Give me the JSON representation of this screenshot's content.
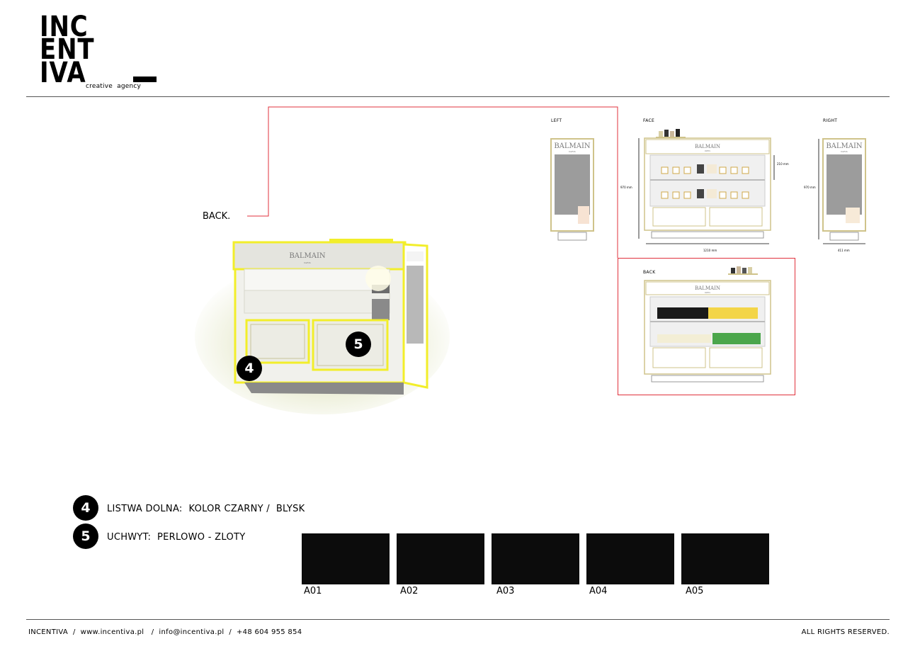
{
  "logo": {
    "lines": [
      "INC",
      "ENT",
      "IVA"
    ],
    "tagline": "creative  agency"
  },
  "render": {
    "back_label": "BACK.",
    "brand": "BALMAIN",
    "brand_sub": "PARIS",
    "markers": [
      "4",
      "5"
    ],
    "highlight_color": "#f2ee2a",
    "connector_color": "#e0313c"
  },
  "views": {
    "left_label": "LEFT",
    "face_label": "FACE",
    "right_label": "RIGHT",
    "back_label": "BACK",
    "height_face": "970 mm",
    "height_right": "970 mm",
    "shelf_height": "210 mm",
    "width_face": "1210 mm",
    "width_right": "411 mm",
    "brand": "BALMAIN",
    "brand_sub": "PARIS"
  },
  "legend": [
    {
      "number": "4",
      "text": "LISTWA DOLNA:  KOLOR CZARNY /  BLYSK"
    },
    {
      "number": "5",
      "text": "UCHWYT:  PERLOWO - ZLOTY"
    }
  ],
  "swatches": [
    {
      "code": "A01",
      "color": "#0c0c0c"
    },
    {
      "code": "A02",
      "color": "#0c0c0c"
    },
    {
      "code": "A03",
      "color": "#0c0c0c"
    },
    {
      "code": "A04",
      "color": "#0c0c0c"
    },
    {
      "code": "A05",
      "color": "#0c0c0c"
    }
  ],
  "footer": {
    "contact": "INCENTIVA  /  www.incentiva.pl   /  info@incentiva.pl  /  +48 604 955 854",
    "rights": "ALL RIGHTS RESERVED."
  }
}
